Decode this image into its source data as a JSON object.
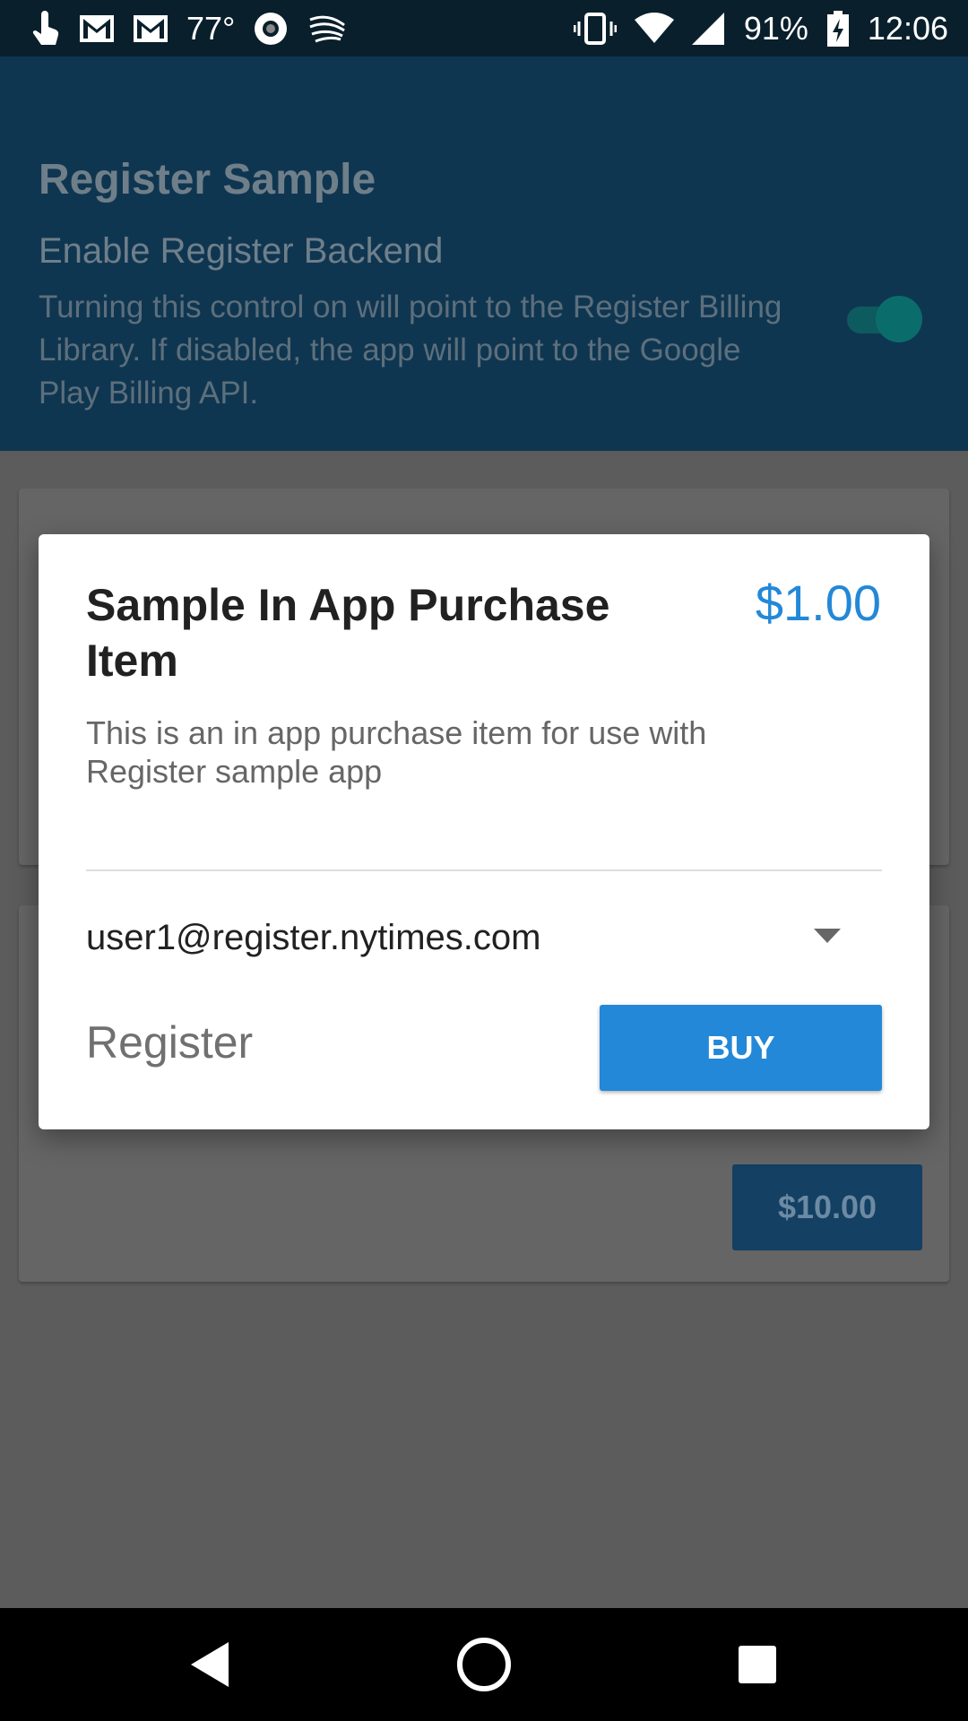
{
  "status_bar": {
    "temperature": "77°",
    "battery": "91%",
    "time": "12:06",
    "icons_left": [
      "touch-icon",
      "gmail-icon",
      "gmail-icon",
      "weather-icon",
      "record-icon",
      "swiftkey-icon"
    ],
    "icons_right": [
      "vibrate-icon",
      "wifi-icon",
      "signal-icon",
      "battery-charging-icon"
    ]
  },
  "app": {
    "title": "Register Sample",
    "preference": {
      "title": "Enable Register Backend",
      "description": "Turning this control on will point to the Register Billing Library. If disabled, the app will point to the Google Play Billing API.",
      "enabled": true
    }
  },
  "background_card": {
    "price_button": "$10.00"
  },
  "dialog": {
    "item_title": "Sample In App Purchase Item",
    "price": "$1.00",
    "description": "This is an in app purchase item for use with Register sample app",
    "account": "user1@register.nytimes.com",
    "provider_label": "Register",
    "buy_label": "BUY"
  },
  "colors": {
    "accent": "#2388d8",
    "appbar_dimmed": "#0f3651",
    "scrim_background": "#5c5c5c"
  }
}
